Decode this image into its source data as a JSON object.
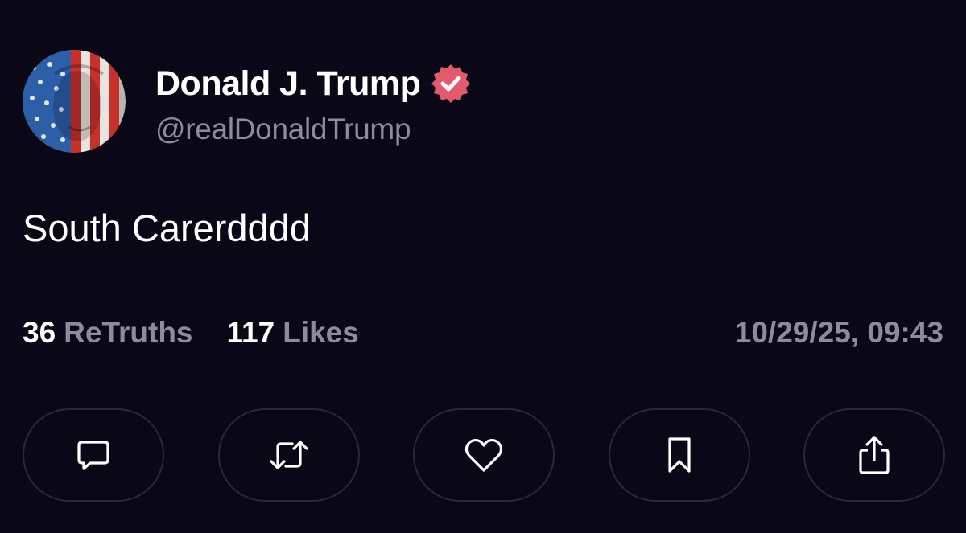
{
  "author": {
    "display_name": "Donald J. Trump",
    "handle": "@realDonaldTrump",
    "verified": true,
    "verified_color": "#e25b6d",
    "avatar_icon": "american-flag-face-avatar"
  },
  "post": {
    "text": "South Carerdddd"
  },
  "stats": {
    "retruths_count": "36",
    "retruths_label": "ReTruths",
    "likes_count": "117",
    "likes_label": "Likes",
    "timestamp": "10/29/25, 09:43"
  },
  "actions": [
    {
      "name": "reply",
      "icon": "comment-icon"
    },
    {
      "name": "retruth",
      "icon": "repost-icon"
    },
    {
      "name": "like",
      "icon": "heart-icon"
    },
    {
      "name": "bookmark",
      "icon": "bookmark-icon"
    },
    {
      "name": "share",
      "icon": "share-icon"
    }
  ],
  "colors": {
    "background": "#0a0817",
    "primary_text": "#ffffff",
    "secondary_text": "#8e8ba0",
    "button_border": "#2a2740"
  }
}
